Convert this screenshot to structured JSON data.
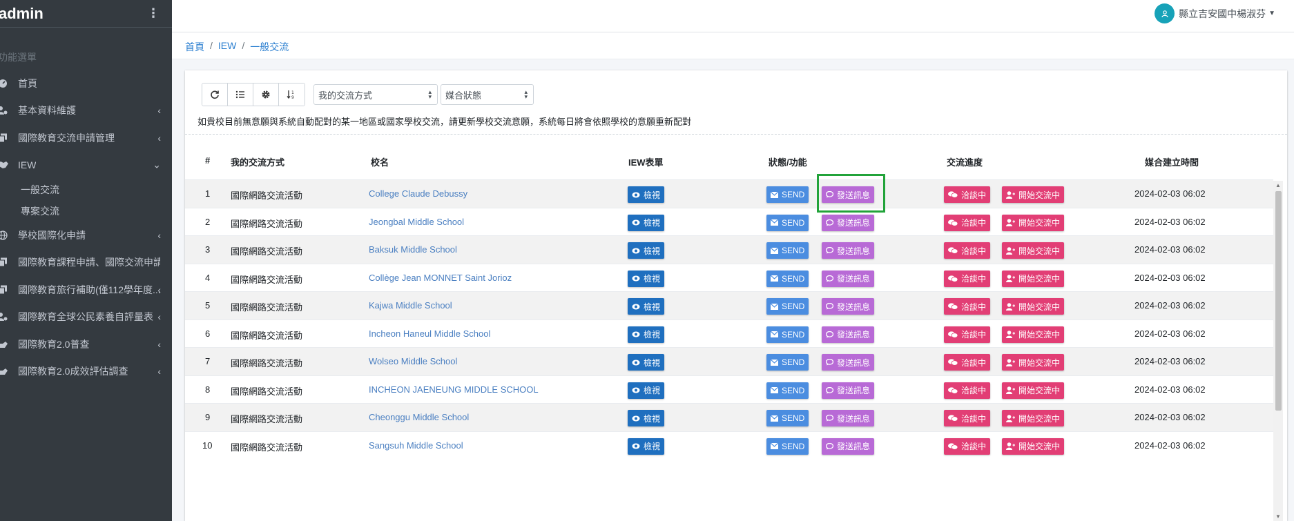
{
  "sidebar": {
    "brand": "admin",
    "menu_header": "功能選單",
    "items": [
      {
        "label": "首頁",
        "icon": "dashboard-icon",
        "chevron": ""
      },
      {
        "label": "基本資料維護",
        "icon": "users-cog-icon",
        "chevron": "‹"
      },
      {
        "label": "國際教育交流申請管理",
        "icon": "copy-icon",
        "chevron": "‹"
      },
      {
        "label": "IEW",
        "icon": "handshake-icon",
        "chevron": "⌄"
      }
    ],
    "sub_items": [
      "一般交流",
      "專案交流"
    ],
    "items2": [
      {
        "label": "學校國際化申請",
        "icon": "globe-icon",
        "chevron": "‹"
      },
      {
        "label": "國際教育課程申請、國際交流申請",
        "icon": "copy-icon",
        "chevron": ""
      },
      {
        "label": "國際教育旅行補助(僅112學年度...",
        "icon": "copy-icon",
        "chevron": "‹"
      },
      {
        "label": "國際教育全球公民素養自評量表",
        "icon": "users-cog-icon",
        "chevron": "‹"
      },
      {
        "label": "國際教育2.0普查",
        "icon": "hand-icon",
        "chevron": "‹"
      },
      {
        "label": "國際教育2.0成效評估調查",
        "icon": "hand-icon",
        "chevron": "‹"
      }
    ]
  },
  "header": {
    "user_name": "縣立吉安國中楊淑芬"
  },
  "breadcrumb": {
    "home": "首頁",
    "iew": "IEW",
    "current": "一般交流",
    "sep": "/"
  },
  "toolbar": {
    "select1": "我的交流方式",
    "select2": "媒合狀態"
  },
  "notice": "如貴校目前無意願與系統自動配對的某一地區或國家學校交流，請更新學校交流意願，系統每日將會依照學校的意願重新配對",
  "table": {
    "headers": {
      "num": "#",
      "method": "我的交流方式",
      "school": "校名",
      "form": "IEW表單",
      "status": "狀態/功能",
      "progress": "交流進度",
      "created": "媒合建立時間"
    },
    "labels": {
      "view": "檢視",
      "send": "SEND",
      "message": "發送訊息",
      "talk": "洽談中",
      "start": "開始交流中"
    },
    "rows": [
      {
        "num": "1",
        "method": "國際網路交流活動",
        "school": "College Claude Debussy",
        "created": "2024-02-03 06:02"
      },
      {
        "num": "2",
        "method": "國際網路交流活動",
        "school": "Jeongbal Middle School",
        "created": "2024-02-03 06:02"
      },
      {
        "num": "3",
        "method": "國際網路交流活動",
        "school": "Baksuk Middle School",
        "created": "2024-02-03 06:02"
      },
      {
        "num": "4",
        "method": "國際網路交流活動",
        "school": "Collège Jean MONNET Saint Jorioz",
        "created": "2024-02-03 06:02"
      },
      {
        "num": "5",
        "method": "國際網路交流活動",
        "school": "Kajwa Middle School",
        "created": "2024-02-03 06:02"
      },
      {
        "num": "6",
        "method": "國際網路交流活動",
        "school": "Incheon Haneul Middle School",
        "created": "2024-02-03 06:02"
      },
      {
        "num": "7",
        "method": "國際網路交流活動",
        "school": "Wolseo Middle School",
        "created": "2024-02-03 06:02"
      },
      {
        "num": "8",
        "method": "國際網路交流活動",
        "school": "INCHEON JAENEUNG MIDDLE SCHOOL",
        "created": "2024-02-03 06:02"
      },
      {
        "num": "9",
        "method": "國際網路交流活動",
        "school": "Cheonggu Middle School",
        "created": "2024-02-03 06:02"
      },
      {
        "num": "10",
        "method": "國際網路交流活動",
        "school": "Sangsuh Middle School",
        "created": "2024-02-03 06:02"
      }
    ]
  },
  "colors": {
    "sidebar_bg": "#343a40",
    "view_btn": "#1f6fbf",
    "send_btn": "#4b8de0",
    "message_btn": "#b86ad6",
    "progress_btn": "#e23e75",
    "highlight": "#22a33a"
  }
}
